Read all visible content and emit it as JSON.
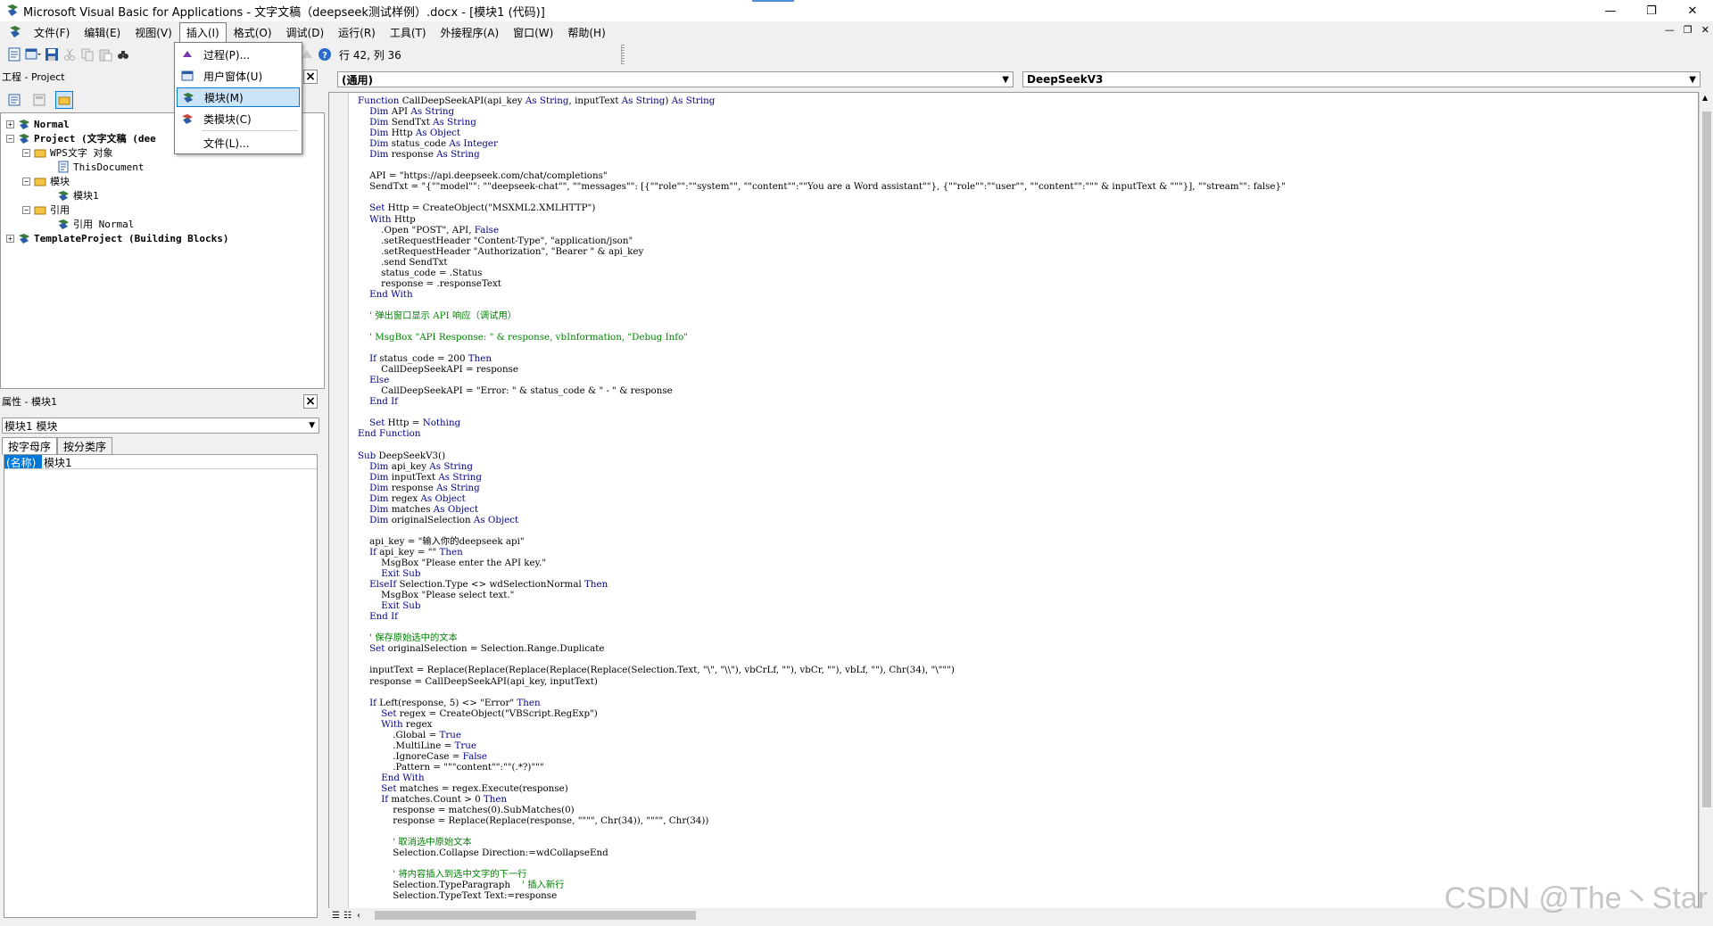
{
  "window": {
    "title": "Microsoft Visual Basic for Applications - 文字文稿（deepseek测试样例）.docx - [模块1 (代码)]",
    "buttons": [
      "—",
      "❐",
      "✕"
    ]
  },
  "menubar": {
    "items": [
      "文件(F)",
      "编辑(E)",
      "视图(V)",
      "插入(I)",
      "格式(O)",
      "调试(D)",
      "运行(R)",
      "工具(T)",
      "外接程序(A)",
      "窗口(W)",
      "帮助(H)"
    ],
    "mdi_buttons": [
      "—",
      "❐",
      "✕"
    ]
  },
  "toolbar": {
    "position": "行 42, 列 36"
  },
  "insert_menu": {
    "items": [
      "过程(P)...",
      "用户窗体(U)",
      "模块(M)",
      "类模块(C)",
      "文件(L)..."
    ],
    "highlighted": "模块(M)"
  },
  "project_panel": {
    "title": "工程 - Project",
    "tree": [
      {
        "label": "Normal",
        "bold": true
      },
      {
        "label": "Project (文字文稿 (dee",
        "bold": true
      },
      {
        "label": "WPS文字 对象",
        "bold": false
      },
      {
        "label": "ThisDocument",
        "bold": false
      },
      {
        "label": "模块",
        "bold": false
      },
      {
        "label": "模块1",
        "bold": false
      },
      {
        "label": "引用",
        "bold": false
      },
      {
        "label": "引用 Normal",
        "bold": false
      },
      {
        "label": "TemplateProject (Building Blocks)",
        "bold": true
      }
    ]
  },
  "properties_panel": {
    "title": "属性 - 模块1",
    "object": "模块1 模块",
    "tabs": [
      "按字母序",
      "按分类序"
    ],
    "rows": [
      {
        "name": "(名称)",
        "value": "模块1"
      }
    ]
  },
  "code_window": {
    "object_dropdown": "(通用)",
    "procedure_dropdown": "DeepSeekV3",
    "lines": [
      "Function CallDeepSeekAPI(api_key As String, inputText As String) As String",
      "    Dim API As String",
      "    Dim SendTxt As String",
      "    Dim Http As Object",
      "    Dim status_code As Integer",
      "    Dim response As String",
      "",
      "    API = \"https://api.deepseek.com/chat/completions\"",
      "    SendTxt = \"{\"\"model\"\": \"\"deepseek-chat\"\", \"\"messages\"\": [{\"\"role\"\":\"\"system\"\", \"\"content\"\":\"\"You are a Word assistant\"\"}, {\"\"role\"\":\"\"user\"\", \"\"content\"\":\"\"\" & inputText & \"\"\"}], \"\"stream\"\": false}\"",
      "",
      "    Set Http = CreateObject(\"MSXML2.XMLHTTP\")",
      "    With Http",
      "        .Open \"POST\", API, False",
      "        .setRequestHeader \"Content-Type\", \"application/json\"",
      "        .setRequestHeader \"Authorization\", \"Bearer \" & api_key",
      "        .send SendTxt",
      "        status_code = .Status",
      "        response = .responseText",
      "    End With",
      "",
      "    ' 弹出窗口显示 API 响应（调试用）",
      "",
      "    ' MsgBox \"API Response: \" & response, vbInformation, \"Debug Info\"",
      "",
      "    If status_code = 200 Then",
      "        CallDeepSeekAPI = response",
      "    Else",
      "        CallDeepSeekAPI = \"Error: \" & status_code & \" - \" & response",
      "    End If",
      "",
      "    Set Http = Nothing",
      "End Function",
      "",
      "Sub DeepSeekV3()",
      "    Dim api_key As String",
      "    Dim inputText As String",
      "    Dim response As String",
      "    Dim regex As Object",
      "    Dim matches As Object",
      "    Dim originalSelection As Object",
      "",
      "    api_key = \"输入你的deepseek api\"",
      "    If api_key = \"\" Then",
      "        MsgBox \"Please enter the API key.\"",
      "        Exit Sub",
      "    ElseIf Selection.Type <> wdSelectionNormal Then",
      "        MsgBox \"Please select text.\"",
      "        Exit Sub",
      "    End If",
      "",
      "    ' 保存原始选中的文本",
      "    Set originalSelection = Selection.Range.Duplicate",
      "",
      "    inputText = Replace(Replace(Replace(Replace(Replace(Selection.Text, \"\\\", \"\\\\\"), vbCrLf, \"\"), vbCr, \"\"), vbLf, \"\"), Chr(34), \"\\\"\"\")",
      "    response = CallDeepSeekAPI(api_key, inputText)",
      "",
      "    If Left(response, 5) <> \"Error\" Then",
      "        Set regex = CreateObject(\"VBScript.RegExp\")",
      "        With regex",
      "            .Global = True",
      "            .MultiLine = True",
      "            .IgnoreCase = False",
      "            .Pattern = \"\"\"content\"\":\"\"(.*?)\"\"\"",
      "        End With",
      "        Set matches = regex.Execute(response)",
      "        If matches.Count > 0 Then",
      "            response = matches(0).SubMatches(0)",
      "            response = Replace(Replace(response, \"\"\"\", Chr(34)), \"\"\"\", Chr(34))",
      "",
      "            ' 取消选中原始文本",
      "            Selection.Collapse Direction:=wdCollapseEnd",
      "",
      "            ' 将内容插入到选中文字的下一行",
      "            Selection.TypeParagraph    ' 插入新行",
      "            Selection.TypeText Text:=response"
    ]
  },
  "watermark": "CSDN @The丶Star"
}
